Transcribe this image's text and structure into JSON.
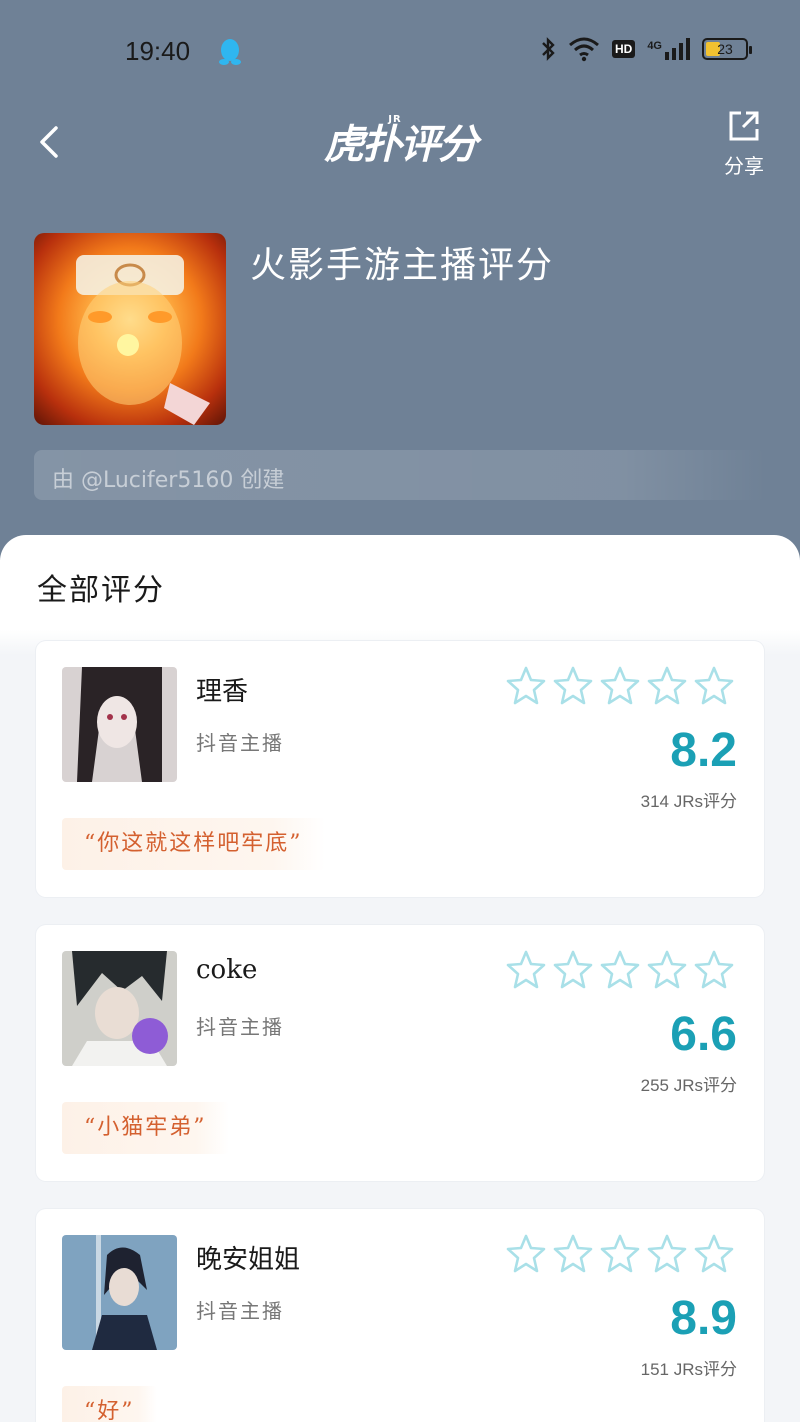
{
  "status_bar": {
    "time": "19:40",
    "network": "4G",
    "hd": "HD",
    "battery": "23"
  },
  "nav": {
    "logo_sup": "JR",
    "logo": "虎扑评分",
    "share_label": "分享"
  },
  "topic": {
    "title": "火影手游主播评分",
    "creator": "由 @Lucifer5160 创建"
  },
  "section": {
    "title": "全部评分"
  },
  "cards": [
    {
      "name": "理香",
      "tag": "抖音主播",
      "stars": 0,
      "score": "8.2",
      "count": "314 JRs评分",
      "quote": "“你这就这样吧牢底”"
    },
    {
      "name": "coke",
      "tag": "抖音主播",
      "stars": 0,
      "score": "6.6",
      "count": "255 JRs评分",
      "quote": "“小猫牢弟”"
    },
    {
      "name": "晚安姐姐",
      "tag": "抖音主播",
      "stars": 0,
      "score": "8.9",
      "count": "151 JRs评分",
      "quote": "“好”"
    }
  ],
  "colors": {
    "header": "#6f8196",
    "score": "#1ba0b5",
    "star": "#a9e0e8",
    "quote_text": "#d4602f"
  }
}
